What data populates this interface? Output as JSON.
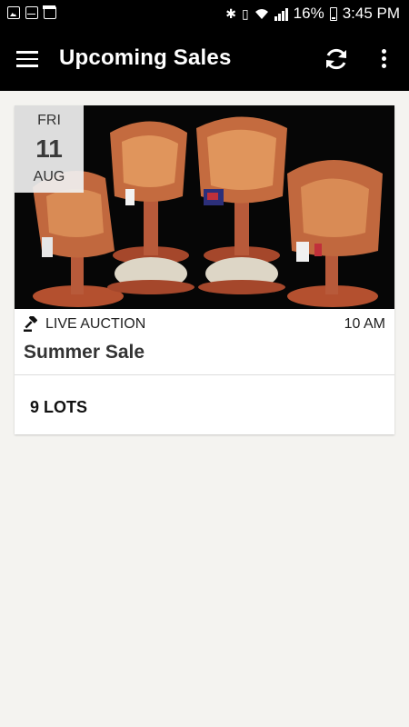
{
  "status_bar": {
    "left_icons": [
      "gallery-icon",
      "mail-icon",
      "calendar-icon"
    ],
    "right_icons": [
      "bluetooth-icon",
      "vibrate-icon",
      "wifi-icon",
      "signal-icon",
      "battery-icon"
    ],
    "battery": "16%",
    "time": "3:45 PM"
  },
  "app_bar": {
    "title": "Upcoming Sales",
    "menu_icon": "hamburger-menu-icon",
    "refresh_icon": "refresh-icon",
    "more_icon": "more-vert-icon",
    "background": "#000000"
  },
  "sales": [
    {
      "image": "saddles-photo",
      "date": {
        "dow": "FRI",
        "day": "11",
        "month": "AUG"
      },
      "type_icon": "gavel-icon",
      "type": "LIVE AUCTION",
      "time": "10 AM",
      "name": "Summer Sale",
      "lots": "9 LOTS"
    }
  ]
}
